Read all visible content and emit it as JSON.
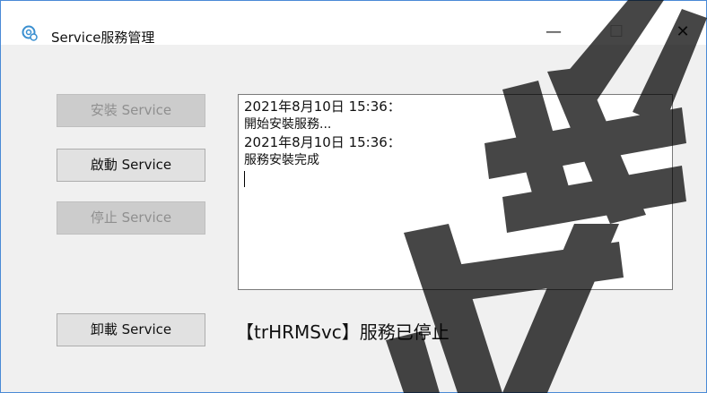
{
  "window": {
    "title": "Service服務管理",
    "minimize_glyph": "—",
    "maximize_glyph": "☐",
    "close_glyph": "✕"
  },
  "buttons": {
    "install": {
      "label": "安裝 Service",
      "enabled": false
    },
    "start": {
      "label": "啟動 Service",
      "enabled": true
    },
    "stop": {
      "label": "停止 Service",
      "enabled": false
    },
    "uninstall": {
      "label": "卸載 Service",
      "enabled": true
    }
  },
  "log": {
    "lines": [
      "2021年8月10日 15:36：",
      "開始安裝服務...",
      "2021年8月10日 15:36：",
      "服務安裝完成"
    ]
  },
  "status": {
    "text": "【trHRMSvc】服務已停止"
  },
  "colors": {
    "accent_border": "#4a8ad6",
    "watermark": "#000000"
  }
}
